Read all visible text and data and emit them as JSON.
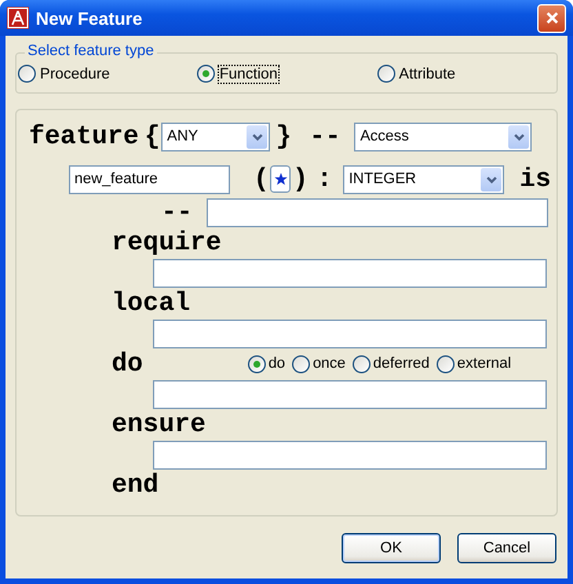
{
  "window": {
    "title": "New Feature"
  },
  "feature_type": {
    "legend": "Select feature type",
    "options": [
      {
        "label": "Procedure",
        "selected": false
      },
      {
        "label": "Function",
        "selected": true
      },
      {
        "label": "Attribute",
        "selected": false
      }
    ]
  },
  "header": {
    "keyword": "feature",
    "open_brace": "{",
    "export": "ANY",
    "close_brace": "}",
    "dashes": "--",
    "category": "Access"
  },
  "signature": {
    "name": "new_feature",
    "open_paren": "(",
    "close_paren": ")",
    "colon": ":",
    "type": "INTEGER",
    "is_keyword": "is"
  },
  "comment": {
    "dashes": "--"
  },
  "clauses": [
    {
      "keyword": "require",
      "kind": "field"
    },
    {
      "keyword": "local",
      "kind": "field"
    },
    {
      "keyword": "do",
      "kind": "body",
      "options": [
        {
          "label": "do",
          "selected": true
        },
        {
          "label": "once",
          "selected": false
        },
        {
          "label": "deferred",
          "selected": false
        },
        {
          "label": "external",
          "selected": false
        }
      ]
    },
    {
      "keyword": "ensure",
      "kind": "field"
    }
  ],
  "end_keyword": "end",
  "buttons": [
    {
      "label": "OK",
      "kind": "default"
    },
    {
      "label": "Cancel",
      "kind": "normal"
    }
  ]
}
